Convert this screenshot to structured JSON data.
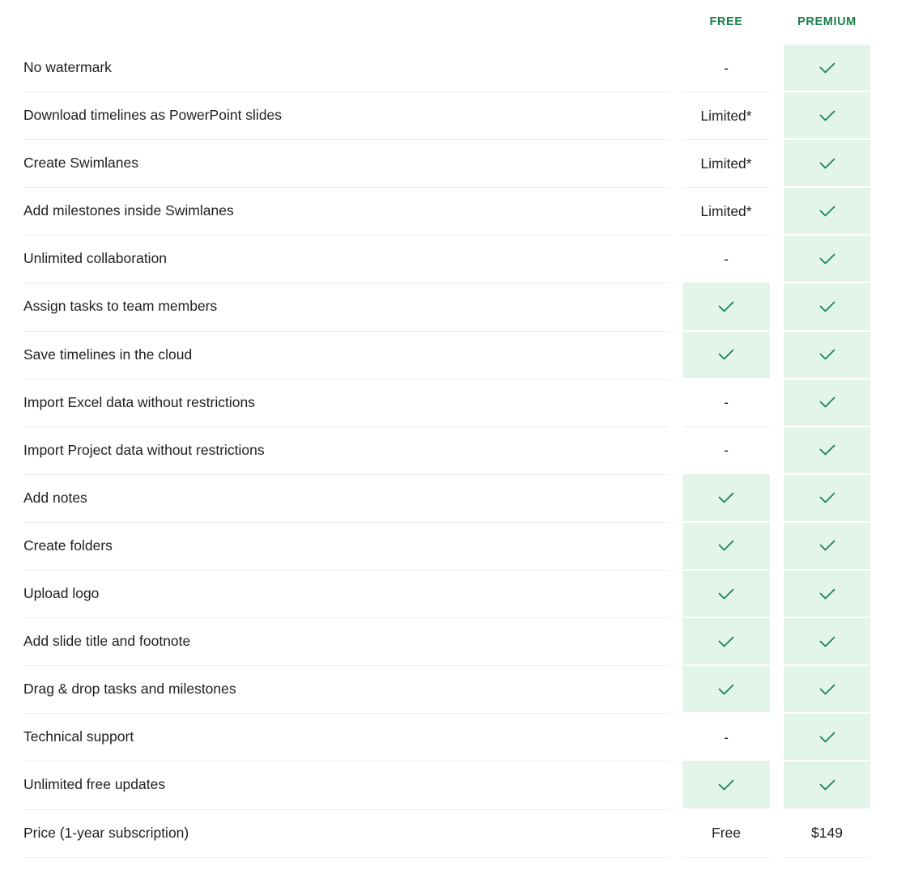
{
  "header": {
    "free_label": "FREE",
    "premium_label": "PREMIUM"
  },
  "colors": {
    "accent": "#16824a",
    "included_cell_bg": "#e3f4ea",
    "divider": "#eeeeee",
    "text": "#1f1f1f"
  },
  "rows": [
    {
      "feature": "No watermark",
      "free": "-",
      "premium": "check-icon"
    },
    {
      "feature": "Download timelines as PowerPoint slides",
      "free": "Limited*",
      "premium": "check-icon"
    },
    {
      "feature": "Create Swimlanes",
      "free": "Limited*",
      "premium": "check-icon"
    },
    {
      "feature": "Add milestones inside Swimlanes",
      "free": "Limited*",
      "premium": "check-icon"
    },
    {
      "feature": "Unlimited collaboration",
      "free": "-",
      "premium": "check-icon"
    },
    {
      "feature": "Assign tasks to team members",
      "free": "check-icon",
      "premium": "check-icon"
    },
    {
      "feature": "Save timelines in the cloud",
      "free": "check-icon",
      "premium": "check-icon"
    },
    {
      "feature": "Import Excel data without restrictions",
      "free": "-",
      "premium": "check-icon"
    },
    {
      "feature": "Import Project data without restrictions",
      "free": "-",
      "premium": "check-icon"
    },
    {
      "feature": "Add notes",
      "free": "check-icon",
      "premium": "check-icon"
    },
    {
      "feature": "Create folders",
      "free": "check-icon",
      "premium": "check-icon"
    },
    {
      "feature": "Upload logo",
      "free": "check-icon",
      "premium": "check-icon"
    },
    {
      "feature": "Add slide title and footnote",
      "free": "check-icon",
      "premium": "check-icon"
    },
    {
      "feature": "Drag & drop tasks and milestones",
      "free": "check-icon",
      "premium": "check-icon"
    },
    {
      "feature": "Technical support",
      "free": "-",
      "premium": "check-icon"
    },
    {
      "feature": "Unlimited free updates",
      "free": "check-icon",
      "premium": "check-icon"
    },
    {
      "feature": "Price (1-year subscription)",
      "free": "Free",
      "premium": "$149"
    }
  ]
}
